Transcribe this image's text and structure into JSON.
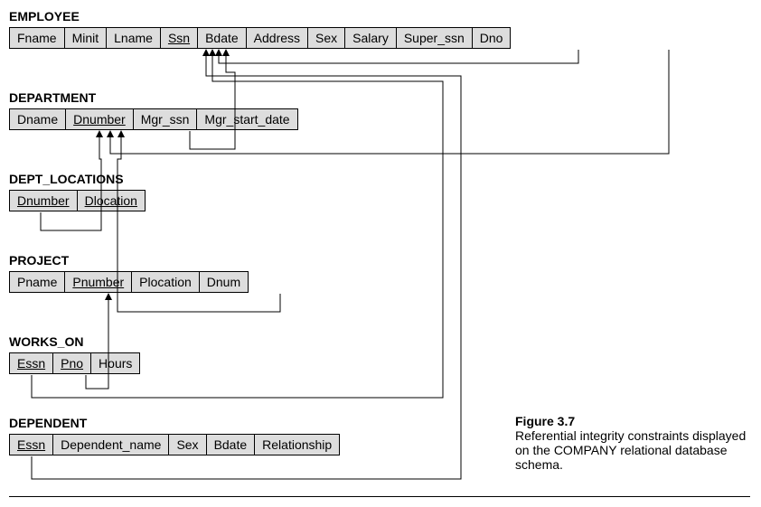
{
  "tables": {
    "employee": {
      "title": "EMPLOYEE",
      "cols": [
        "Fname",
        "Minit",
        "Lname",
        "Ssn",
        "Bdate",
        "Address",
        "Sex",
        "Salary",
        "Super_ssn",
        "Dno"
      ]
    },
    "department": {
      "title": "DEPARTMENT",
      "cols": [
        "Dname",
        "Dnumber",
        "Mgr_ssn",
        "Mgr_start_date"
      ]
    },
    "dept_locations": {
      "title": "DEPT_LOCATIONS",
      "cols": [
        "Dnumber",
        "Dlocation"
      ]
    },
    "project": {
      "title": "PROJECT",
      "cols": [
        "Pname",
        "Pnumber",
        "Plocation",
        "Dnum"
      ]
    },
    "works_on": {
      "title": "WORKS_ON",
      "cols": [
        "Essn",
        "Pno",
        "Hours"
      ]
    },
    "dependent": {
      "title": "DEPENDENT",
      "cols": [
        "Essn",
        "Dependent_name",
        "Sex",
        "Bdate",
        "Relationship"
      ]
    }
  },
  "caption": {
    "title": "Figure 3.7",
    "text": "Referential integrity constraints displayed on the COMPANY relational database schema."
  }
}
